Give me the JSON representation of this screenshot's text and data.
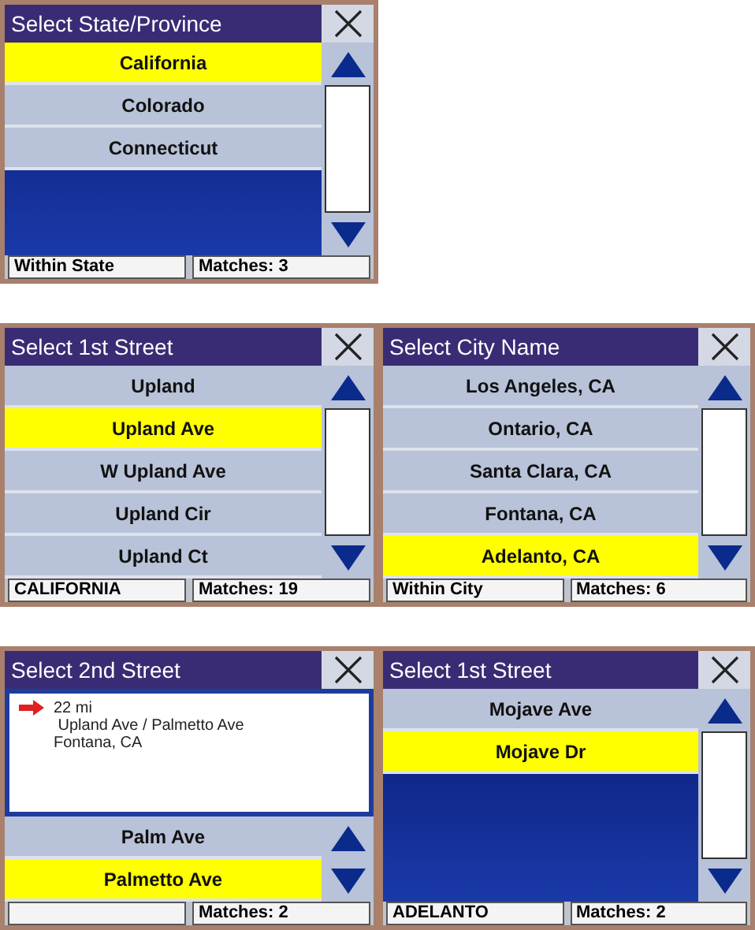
{
  "panels": [
    {
      "kind": "list",
      "title": "Select State/Province",
      "items": [
        {
          "label": "California",
          "selected": true
        },
        {
          "label": "Colorado",
          "selected": false
        },
        {
          "label": "Connecticut",
          "selected": false
        }
      ],
      "status": {
        "left": "Within State",
        "right": "Matches:  3"
      }
    },
    {
      "kind": "list",
      "title": "Select 1st Street",
      "items": [
        {
          "label": "Upland",
          "selected": false
        },
        {
          "label": "Upland Ave",
          "selected": true
        },
        {
          "label": "W Upland Ave",
          "selected": false
        },
        {
          "label": "Upland Cir",
          "selected": false
        },
        {
          "label": "Upland Ct",
          "selected": false
        }
      ],
      "status": {
        "left": "CALIFORNIA",
        "right": "Matches: 19"
      }
    },
    {
      "kind": "list",
      "title": "Select City Name",
      "items": [
        {
          "label": "Los Angeles, CA",
          "selected": false
        },
        {
          "label": "Ontario, CA",
          "selected": false
        },
        {
          "label": "Santa Clara, CA",
          "selected": false
        },
        {
          "label": "Fontana, CA",
          "selected": false
        },
        {
          "label": "Adelanto, CA",
          "selected": true
        }
      ],
      "status": {
        "left": "Within City",
        "right": "Matches:  6"
      }
    },
    {
      "kind": "detail",
      "title": "Select 2nd Street",
      "info": {
        "distance": "22 mi",
        "lines": [
          " Upland Ave / Palmetto Ave",
          "Fontana, CA"
        ]
      },
      "items": [
        {
          "label": "Palm Ave",
          "selected": false
        },
        {
          "label": "Palmetto Ave",
          "selected": true
        }
      ],
      "status": {
        "right": "Matches:  2"
      }
    },
    {
      "kind": "list",
      "title": "Select 1st Street",
      "items": [
        {
          "label": "Mojave Ave",
          "selected": false
        },
        {
          "label": "Mojave Dr",
          "selected": true
        }
      ],
      "status": {
        "left": "ADELANTO",
        "right": "Matches:  2"
      }
    }
  ]
}
